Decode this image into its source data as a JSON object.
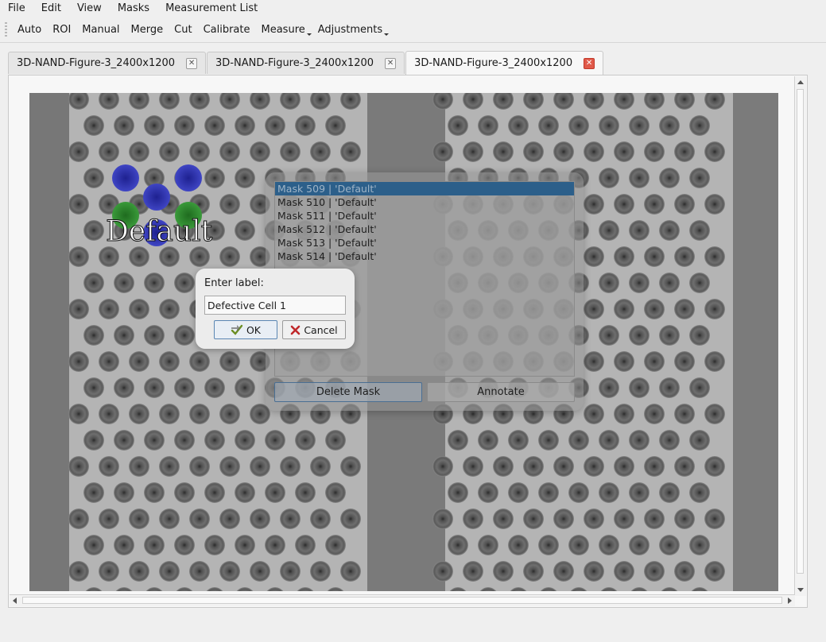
{
  "menubar": {
    "items": [
      "File",
      "Edit",
      "View",
      "Masks",
      "Measurement List"
    ]
  },
  "toolbar": {
    "items": [
      {
        "label": "Auto",
        "dropdown": false
      },
      {
        "label": "ROI",
        "dropdown": false
      },
      {
        "label": "Manual",
        "dropdown": false
      },
      {
        "label": "Merge",
        "dropdown": false
      },
      {
        "label": "Cut",
        "dropdown": false
      },
      {
        "label": "Calibrate",
        "dropdown": false
      },
      {
        "label": "Measure",
        "dropdown": true
      },
      {
        "label": "Adjustments",
        "dropdown": true
      }
    ]
  },
  "tabs": [
    {
      "label": "3D-NAND-Figure-3_2400x1200",
      "active": false,
      "close_icon": "close-icon"
    },
    {
      "label": "3D-NAND-Figure-3_2400x1200",
      "active": false,
      "close_icon": "close-icon"
    },
    {
      "label": "3D-NAND-Figure-3_2400x1200",
      "active": true,
      "close_icon": "close-icon"
    }
  ],
  "canvas": {
    "overlay_label": "Default",
    "mask_colors": {
      "blue": "#3a3fb8",
      "green": "#2d8a2d"
    }
  },
  "mask_dialog": {
    "items": [
      {
        "label": "Mask 509 | 'Default'",
        "selected": true
      },
      {
        "label": "Mask 510 | 'Default'",
        "selected": false
      },
      {
        "label": "Mask 511 | 'Default'",
        "selected": false
      },
      {
        "label": "Mask 512 | 'Default'",
        "selected": false
      },
      {
        "label": "Mask 513 | 'Default'",
        "selected": false
      },
      {
        "label": "Mask 514 | 'Default'",
        "selected": false
      }
    ],
    "delete_label": "Delete Mask",
    "annotate_label": "Annotate"
  },
  "label_dialog": {
    "prompt": "Enter label:",
    "value": "Defective Cell 1",
    "ok_label": "OK",
    "ok_icon": "checkmark-arrow-icon",
    "cancel_label": "Cancel",
    "cancel_icon": "red-x-icon"
  }
}
